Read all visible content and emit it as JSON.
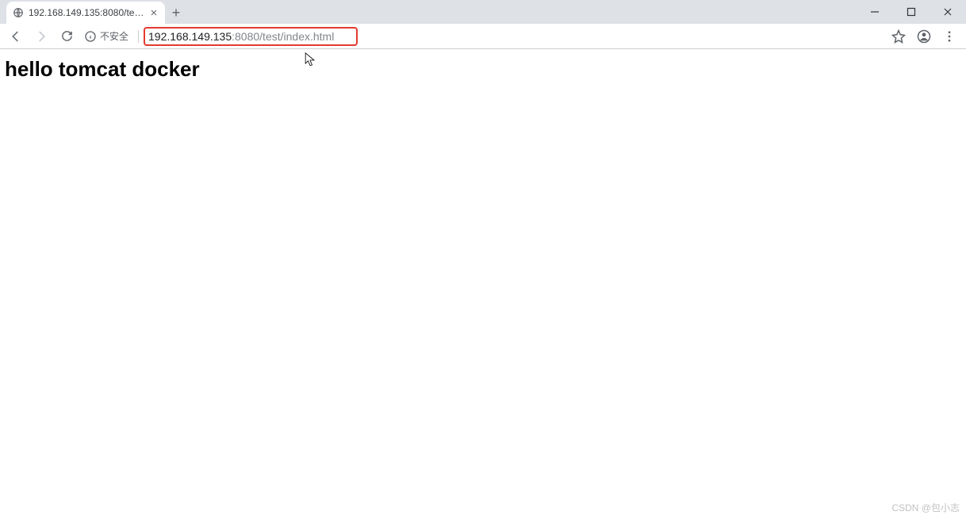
{
  "window": {
    "minimize": "—",
    "maximize": "❐",
    "close": "✕"
  },
  "tab": {
    "title": "192.168.149.135:8080/test/ind",
    "close": "✕"
  },
  "newtab": "+",
  "nav": {
    "security_label": "不安全"
  },
  "address": {
    "host": "192.168.149.135",
    "port": ":8080",
    "path": "/test/index.html",
    "full": "192.168.149.135:8080/test/index.html"
  },
  "page": {
    "heading": "hello tomcat docker"
  },
  "watermark": "CSDN @包小志"
}
